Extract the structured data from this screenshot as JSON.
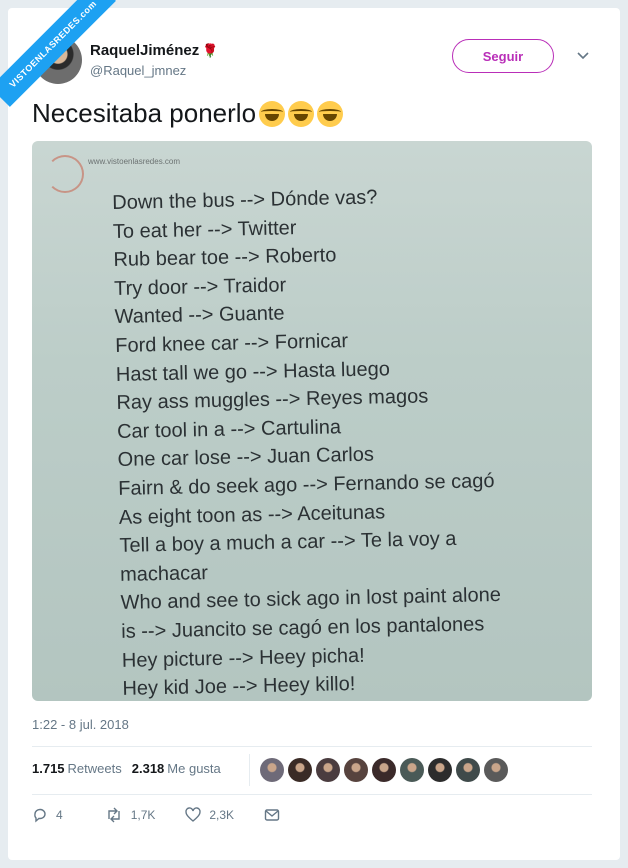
{
  "watermark": "VISTOENLASREDES.com",
  "author": {
    "name": "RaquelJiménez",
    "handle": "@Raquel_jmnez"
  },
  "follow_label": "Seguir",
  "tweet_text": "Necesitaba ponerlo",
  "photo": {
    "header_text": "www.vistoenlasredes.com",
    "lines": [
      "Down the bus --> Dónde vas?",
      "To eat her --> Twitter",
      "Rub bear toe --> Roberto",
      "Try door --> Traidor",
      "Wanted --> Guante",
      "Ford knee car --> Fornicar",
      "Hast tall we go --> Hasta luego",
      "Ray ass muggles --> Reyes magos",
      "Car tool in a --> Cartulina",
      "One car lose --> Juan Carlos",
      "Fairn & do seek ago --> Fernando se cagó",
      "As eight toon as --> Aceitunas",
      "Tell a boy a much a car --> Te la voy a",
      "machacar",
      "Who and see to sick ago in lost paint alone",
      "is --> Juancito se cagó en los pantalones",
      "Hey picture --> Heey picha!",
      "Hey kid Joe --> Heey killo!"
    ]
  },
  "timestamp": "1:22 - 8 jul. 2018",
  "stats": {
    "retweets_count": "1.715",
    "retweets_label": "Retweets",
    "likes_count": "2.318",
    "likes_label": "Me gusta"
  },
  "actions": {
    "reply_count": "4",
    "retweet_count": "1,7K",
    "like_count": "2,3K"
  },
  "colors": {
    "accent": "#b92eb8",
    "text": "#14171a",
    "muted": "#657786"
  },
  "liker_colors": [
    "#6e6a78",
    "#3a2b26",
    "#4a3c3f",
    "#57433e",
    "#3b2a2a",
    "#4a5a57",
    "#2c2c2c",
    "#3f4a4a",
    "#5a5a5a"
  ]
}
